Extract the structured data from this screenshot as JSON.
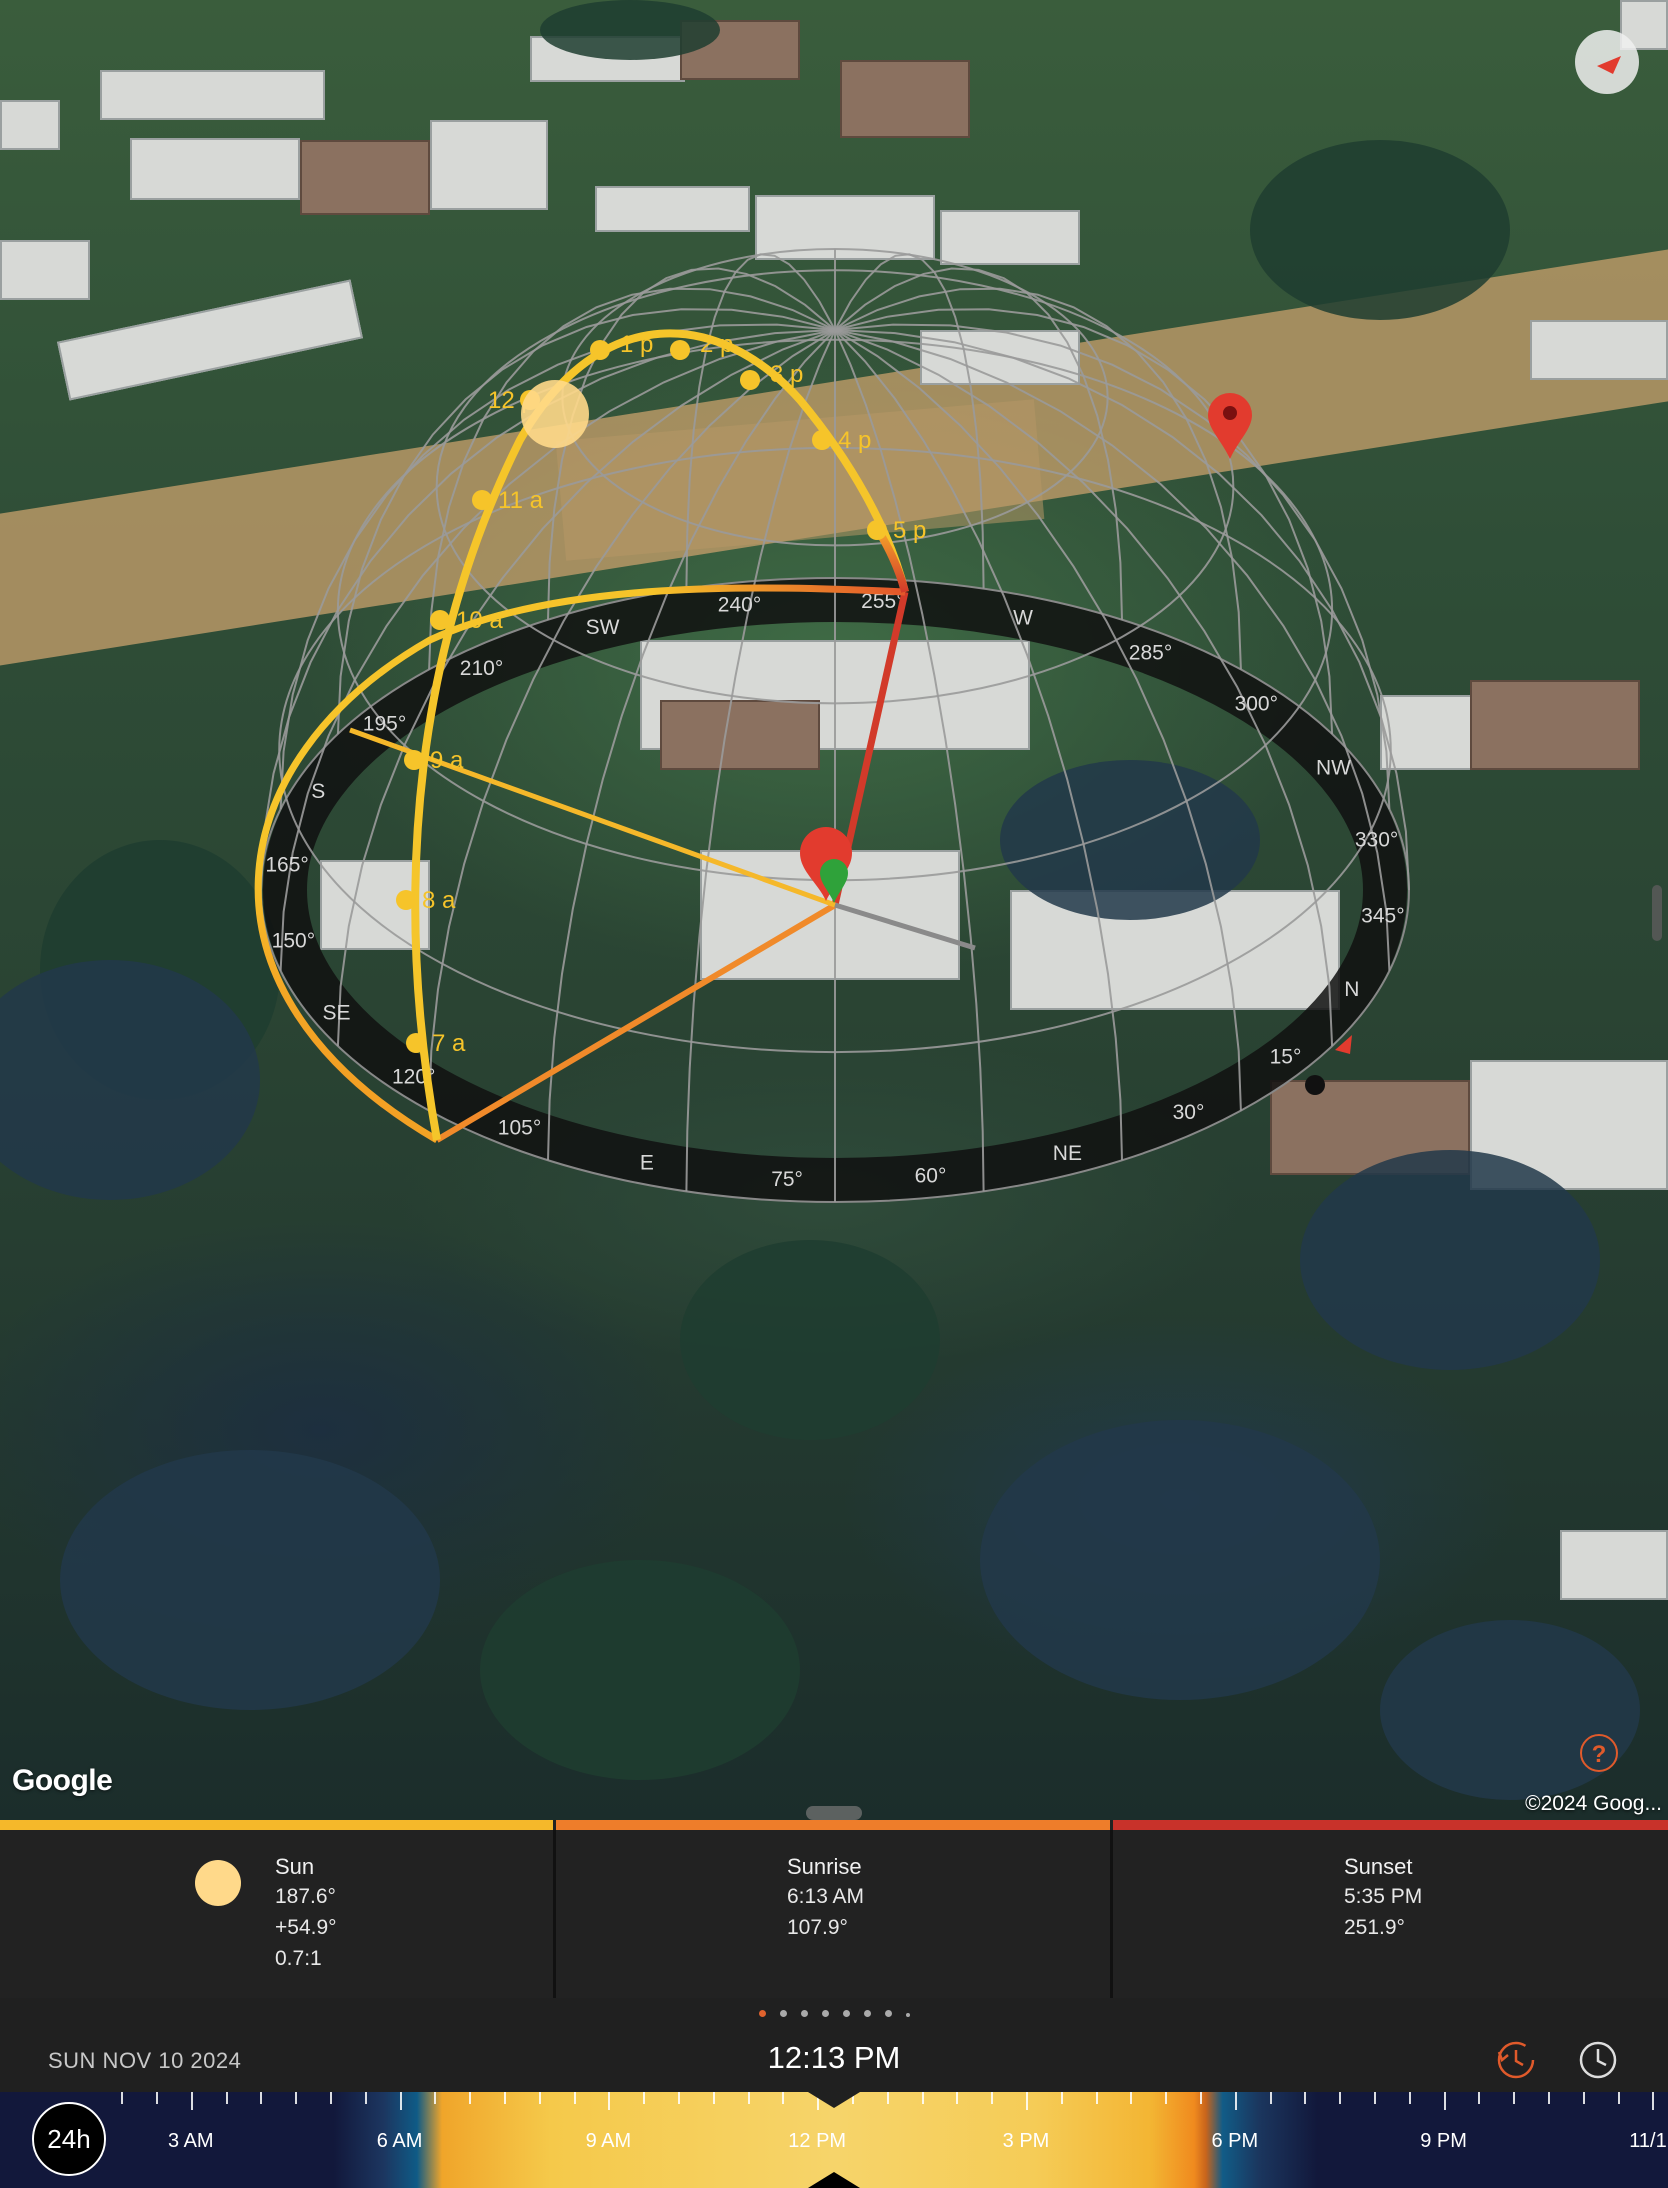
{
  "map": {
    "provider_logo": "Google",
    "copyright": "©2024 Goog...",
    "help_label": "?",
    "compass_icon": "compass-icon"
  },
  "sun_path": {
    "hour_labels": [
      "7 a",
      "8 a",
      "9 a",
      "10 a",
      "11 a",
      "12 p",
      "1 p",
      "2 p",
      "3 p",
      "4 p",
      "5 p"
    ],
    "dial_labels": [
      "240°",
      "255°",
      "W",
      "285°",
      "300°",
      "NW",
      "330°",
      "345°",
      "N",
      "15°",
      "30°",
      "NE",
      "60°",
      "75°",
      "E",
      "105°",
      "120°",
      "SE",
      "150°",
      "165°",
      "S",
      "195°",
      "210°",
      "SW"
    ],
    "colors": {
      "sun": "#ffd37a",
      "sunrise": "#f08a2a",
      "sunset": "#d23a2a",
      "path": "#f5c12a"
    }
  },
  "info": {
    "sun": {
      "title": "Sun",
      "azimuth": "187.6°",
      "elevation": "+54.9°",
      "ratio": "0.7:1"
    },
    "sunrise": {
      "title": "Sunrise",
      "time": "6:13 AM",
      "azimuth": "107.9°"
    },
    "sunset": {
      "title": "Sunset",
      "time": "5:35 PM",
      "azimuth": "251.9°"
    },
    "bar_colors": {
      "sun": "#f5b82a",
      "sunrise": "#ee7d2a",
      "sunset": "#c8322a"
    }
  },
  "bottom": {
    "date": "SUN NOV 10 2024",
    "time": "12:13 PM",
    "page_count": 8,
    "active_page": 0
  },
  "timeline": {
    "mode_label": "24h",
    "labels": [
      "3 AM",
      "6 AM",
      "9 AM",
      "12 PM",
      "3 PM",
      "6 PM",
      "9 PM",
      "11/1"
    ]
  }
}
